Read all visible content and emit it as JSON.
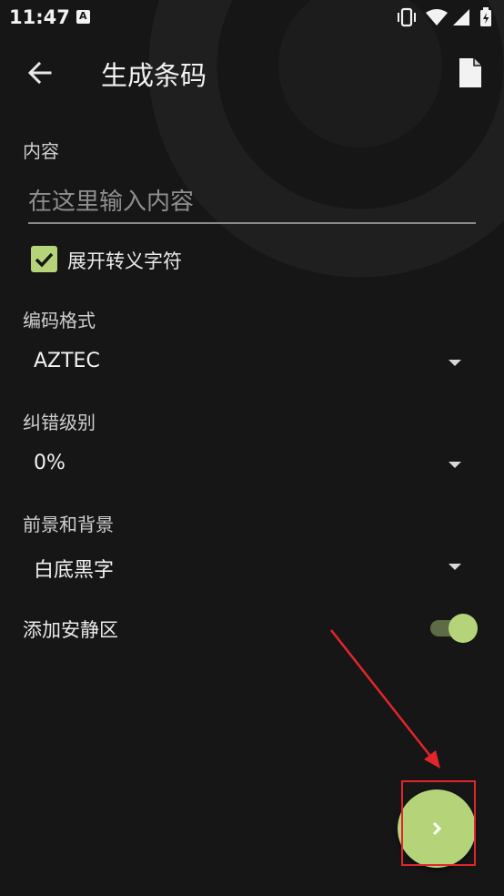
{
  "status_bar": {
    "time": "11:47",
    "app_icon": "A"
  },
  "toolbar": {
    "title": "生成条码",
    "back_icon": "arrow-left-icon",
    "doc_icon": "document-icon"
  },
  "content": {
    "label": "内容",
    "input_value": "",
    "input_placeholder": "在这里输入内容",
    "expand_escape": {
      "label": "展开转义字符",
      "checked": true
    }
  },
  "format": {
    "label": "编码格式",
    "value": "AZTEC"
  },
  "error_correction": {
    "label": "纠错级别",
    "value": "0%"
  },
  "colors": {
    "label": "前景和背景",
    "value": "白底黑字"
  },
  "quiet_zone": {
    "label": "添加安静区",
    "enabled": true
  },
  "fab": {
    "icon": "chevron-right-icon"
  },
  "theme": {
    "accent": "#b5d47a",
    "background": "#161616",
    "annotation": "#e0262b"
  }
}
